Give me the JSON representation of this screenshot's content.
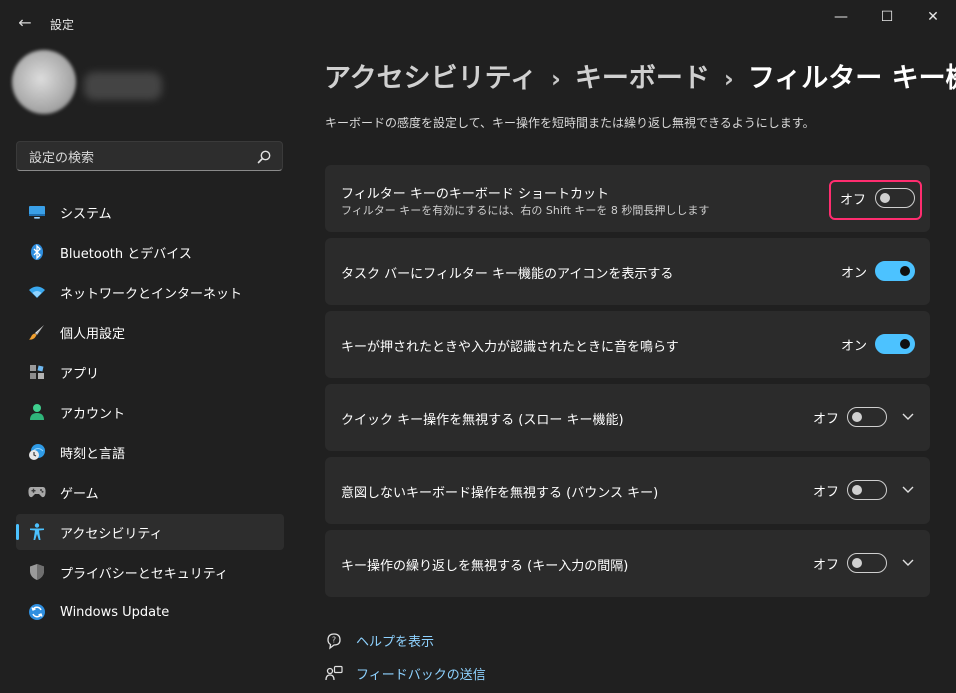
{
  "window": {
    "title": "設定",
    "min_glyph": "—",
    "max_glyph": "☐",
    "close_glyph": "✕",
    "back_glyph": "←"
  },
  "search": {
    "placeholder": "設定の検索"
  },
  "sidebar": {
    "items": [
      {
        "label": "システム",
        "icon": "monitor-icon"
      },
      {
        "label": "Bluetooth とデバイス",
        "icon": "bluetooth-icon"
      },
      {
        "label": "ネットワークとインターネット",
        "icon": "wifi-icon"
      },
      {
        "label": "個人用設定",
        "icon": "brush-icon"
      },
      {
        "label": "アプリ",
        "icon": "apps-icon"
      },
      {
        "label": "アカウント",
        "icon": "person-icon"
      },
      {
        "label": "時刻と言語",
        "icon": "globe-clock-icon"
      },
      {
        "label": "ゲーム",
        "icon": "gamepad-icon"
      },
      {
        "label": "アクセシビリティ",
        "icon": "accessibility-icon",
        "active": true
      },
      {
        "label": "プライバシーとセキュリティ",
        "icon": "shield-icon"
      },
      {
        "label": "Windows Update",
        "icon": "update-icon"
      }
    ]
  },
  "breadcrumb": {
    "level1": "アクセシビリティ",
    "level2": "キーボード",
    "current": "フィルター キー機能",
    "separator": "›"
  },
  "description": "キーボードの感度を設定して、キー操作を短時間または繰り返し無視できるようにします。",
  "settings": [
    {
      "title": "フィルター キーのキーボード ショートカット",
      "subtitle": "フィルター キーを有効にするには、右の Shift キーを 8 秒間長押しします",
      "state": "オフ",
      "on": false,
      "expandable": false,
      "highlighted": true
    },
    {
      "title": "タスク バーにフィルター キー機能のアイコンを表示する",
      "state": "オン",
      "on": true,
      "expandable": false
    },
    {
      "title": "キーが押されたときや入力が認識されたときに音を鳴らす",
      "state": "オン",
      "on": true,
      "expandable": false
    },
    {
      "title": "クイック キー操作を無視する (スロー キー機能)",
      "state": "オフ",
      "on": false,
      "expandable": true
    },
    {
      "title": "意図しないキーボード操作を無視する (バウンス キー)",
      "state": "オフ",
      "on": false,
      "expandable": true
    },
    {
      "title": "キー操作の繰り返しを無視する (キー入力の間隔)",
      "state": "オフ",
      "on": false,
      "expandable": true
    }
  ],
  "footer": {
    "help": "ヘルプを表示",
    "feedback": "フィードバックの送信"
  },
  "colors": {
    "accent": "#4cc2ff",
    "highlight": "#ff2d6f",
    "background": "#202020",
    "card": "#2b2b2b"
  }
}
